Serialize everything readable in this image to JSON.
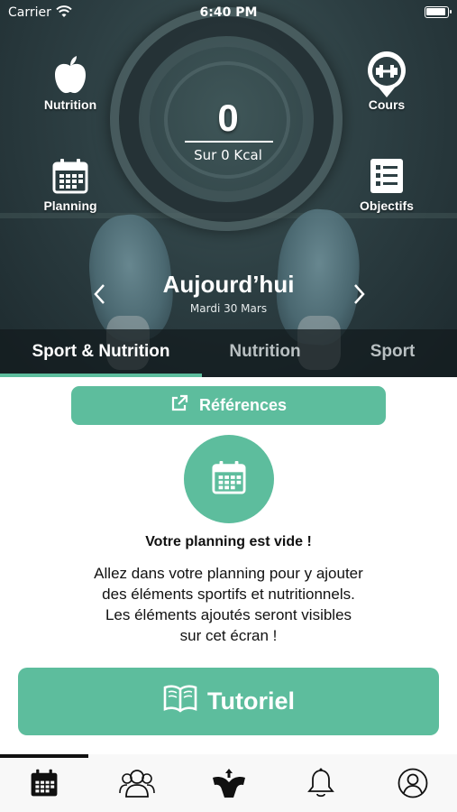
{
  "status_bar": {
    "carrier": "Carrier",
    "time": "6:40 PM"
  },
  "shortcuts": {
    "nutrition": "Nutrition",
    "cours": "Cours",
    "planning": "Planning",
    "objectifs": "Objectifs"
  },
  "calories": {
    "value": "0",
    "subtitle": "Sur 0 Kcal"
  },
  "day": {
    "title": "Aujourd’hui",
    "date": "Mardi 30 Mars"
  },
  "tabs": [
    {
      "label": "Sport & Nutrition",
      "active": true
    },
    {
      "label": "Nutrition",
      "active": false
    },
    {
      "label": "Sport",
      "active": false
    }
  ],
  "references_label": "Références",
  "empty_state": {
    "title": "Votre planning est vide !",
    "lines": [
      "Allez dans votre planning pour y ajouter",
      "des éléments sportifs et nutritionnels.",
      "Les éléments ajoutés seront visibles",
      "sur cet écran !"
    ]
  },
  "tutorial_label": "Tutoriel",
  "bottom_tabs": [
    {
      "icon": "calendar-icon",
      "active": true
    },
    {
      "icon": "users-icon",
      "active": false
    },
    {
      "icon": "body-icon",
      "active": false
    },
    {
      "icon": "bell-icon",
      "active": false
    },
    {
      "icon": "profile-icon",
      "active": false
    }
  ],
  "colors": {
    "accent": "#5dbd9d",
    "tab_overlay": "#121a1d",
    "tabbar_bg": "#f8f8f8"
  }
}
